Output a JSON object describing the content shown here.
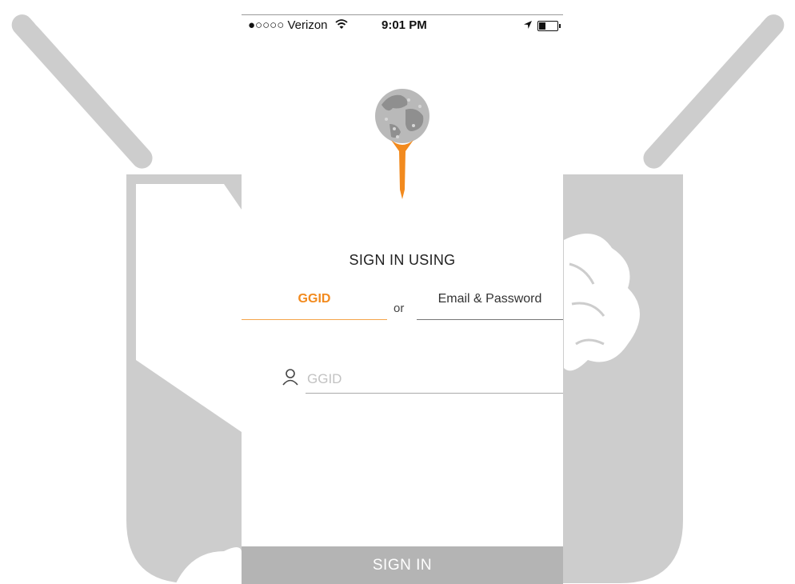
{
  "status_bar": {
    "carrier": "●○○○○ Verizon",
    "time": "9:01 PM"
  },
  "signin": {
    "heading": "SIGN IN USING",
    "tabs": [
      {
        "label": "GGID",
        "active": true
      },
      {
        "label": "Email & Password",
        "active": false
      }
    ],
    "or_text": "or",
    "ggid_field": {
      "placeholder": "GGID",
      "value": ""
    },
    "submit_label": "SIGN IN"
  },
  "colors": {
    "accent": "#f28a1e",
    "button_bg": "#b4b4b4",
    "background_art": "#cdcdcd"
  },
  "icons": [
    "signal-dots-icon",
    "wifi-icon",
    "location-arrow-icon",
    "battery-icon",
    "golf-globe-tee-logo",
    "user-icon"
  ]
}
